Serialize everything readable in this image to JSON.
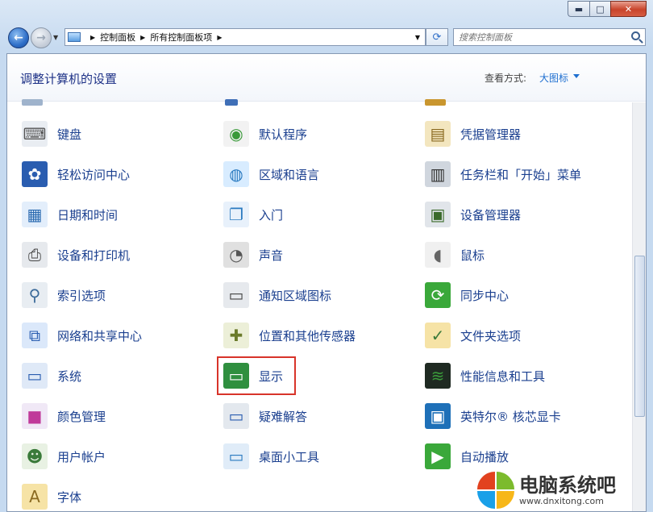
{
  "window": {
    "caption": {
      "minimize": "▬",
      "maximize": "□",
      "close": "✕"
    }
  },
  "address_bar": {
    "crumbs": [
      "控制面板",
      "所有控制面板项"
    ],
    "search_placeholder": "搜索控制面板"
  },
  "header": {
    "title": "调整计算机的设置",
    "view_label": "查看方式:",
    "view_value": "大图标"
  },
  "items": [
    {
      "label": "键盘",
      "icon": "keyboard-icon"
    },
    {
      "label": "默认程序",
      "icon": "default-programs-icon"
    },
    {
      "label": "凭据管理器",
      "icon": "credential-manager-icon"
    },
    {
      "label": "轻松访问中心",
      "icon": "ease-of-access-icon"
    },
    {
      "label": "区域和语言",
      "icon": "region-language-icon"
    },
    {
      "label": "任务栏和「开始」菜单",
      "icon": "taskbar-start-menu-icon"
    },
    {
      "label": "日期和时间",
      "icon": "date-time-icon"
    },
    {
      "label": "入门",
      "icon": "getting-started-icon"
    },
    {
      "label": "设备管理器",
      "icon": "device-manager-icon"
    },
    {
      "label": "设备和打印机",
      "icon": "devices-printers-icon"
    },
    {
      "label": "声音",
      "icon": "sound-icon"
    },
    {
      "label": "鼠标",
      "icon": "mouse-icon"
    },
    {
      "label": "索引选项",
      "icon": "indexing-options-icon"
    },
    {
      "label": "通知区域图标",
      "icon": "notification-area-icon"
    },
    {
      "label": "同步中心",
      "icon": "sync-center-icon"
    },
    {
      "label": "网络和共享中心",
      "icon": "network-sharing-icon"
    },
    {
      "label": "位置和其他传感器",
      "icon": "location-sensors-icon"
    },
    {
      "label": "文件夹选项",
      "icon": "folder-options-icon"
    },
    {
      "label": "系统",
      "icon": "system-icon"
    },
    {
      "label": "显示",
      "icon": "display-icon"
    },
    {
      "label": "性能信息和工具",
      "icon": "performance-icon"
    },
    {
      "label": "颜色管理",
      "icon": "color-management-icon"
    },
    {
      "label": "疑难解答",
      "icon": "troubleshooting-icon"
    },
    {
      "label": "英特尔® 核芯显卡",
      "icon": "intel-graphics-icon"
    },
    {
      "label": "用户帐户",
      "icon": "user-accounts-icon"
    },
    {
      "label": "桌面小工具",
      "icon": "desktop-gadgets-icon"
    },
    {
      "label": "自动播放",
      "icon": "autoplay-icon"
    },
    {
      "label": "字体",
      "icon": "fonts-icon"
    }
  ],
  "watermark": {
    "title": "电脑系统吧",
    "url": "www.dnxitong.com"
  }
}
